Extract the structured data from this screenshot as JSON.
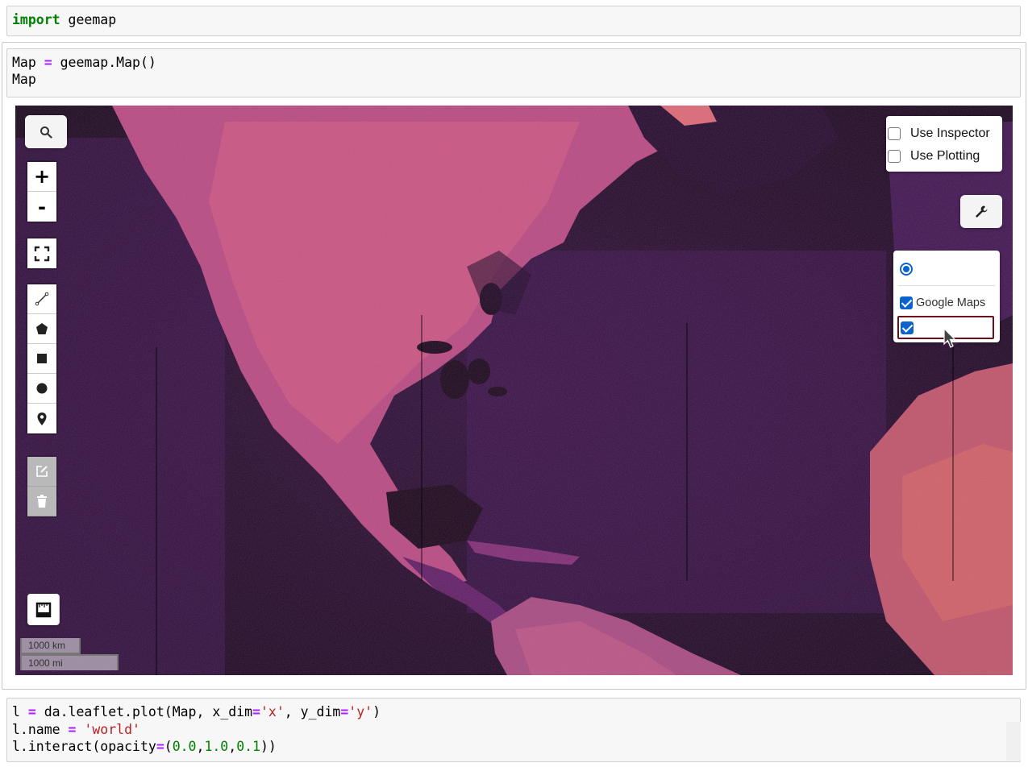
{
  "cells": {
    "cell1": {
      "keyword": "import",
      "module": " geemap"
    },
    "cell2": {
      "line1_a": "Map ",
      "line1_op": "=",
      "line1_b": " geemap.Map()",
      "line2": "Map"
    },
    "cell3": {
      "l1_a": "l ",
      "l1_op": "=",
      "l1_b": " da.leaflet.plot(Map, x_dim",
      "l1_op2": "=",
      "l1_s1": "'x'",
      "l1_c": ", y_dim",
      "l1_op3": "=",
      "l1_s2": "'y'",
      "l1_d": ")",
      "l2_a": "l.name ",
      "l2_op": "=",
      "l2_b": " ",
      "l2_s": "'world'",
      "l3_a": "l.interact(opacity",
      "l3_op": "=",
      "l3_b": "(",
      "l3_n1": "0.0",
      "l3_c1": ",",
      "l3_n2": "1.0",
      "l3_c2": ",",
      "l3_n3": "0.1",
      "l3_d": "))"
    }
  },
  "map": {
    "controls": {
      "search_icon": "search-icon",
      "zoom_in": "+",
      "zoom_out": "-"
    },
    "inspector_panel": {
      "use_inspector_label": "Use Inspector",
      "use_inspector_checked": false,
      "use_plotting_label": "Use Plotting",
      "use_plotting_checked": false
    },
    "layers_panel": {
      "base_layer_selected": true,
      "overlays": [
        {
          "label": "Google Maps",
          "checked": true
        },
        {
          "label": "",
          "checked": true
        }
      ]
    },
    "scale": {
      "km": "1000 km",
      "mi": "1000 mi"
    },
    "colors": {
      "land_hot": "#d9534a",
      "land_mid": "#8a2e8c",
      "ocean": "#1a0a2e"
    }
  }
}
